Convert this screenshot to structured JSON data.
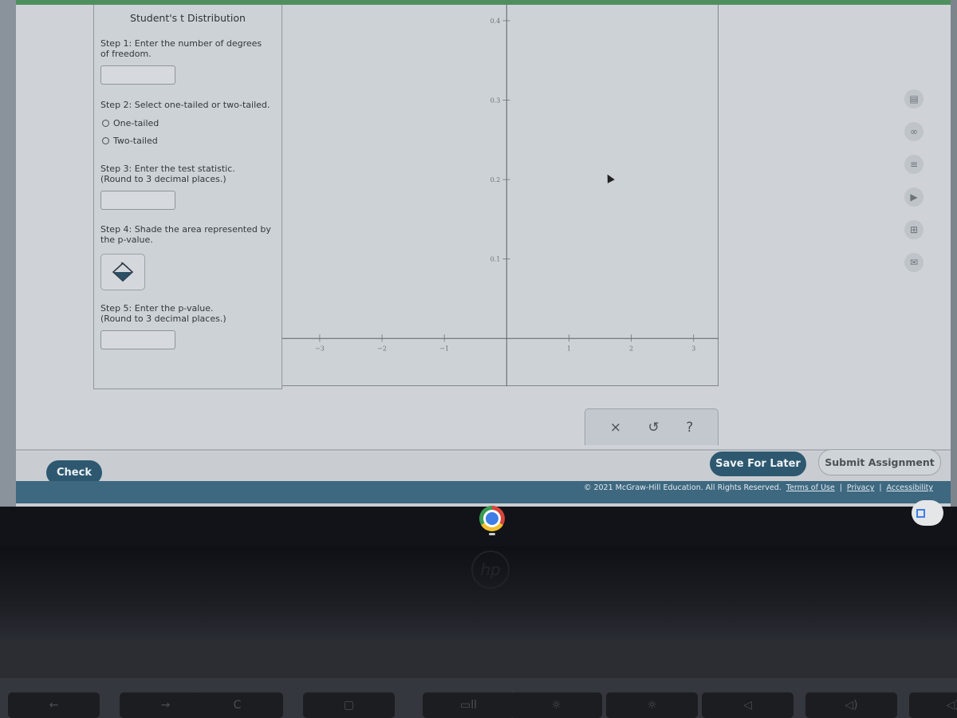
{
  "tool": {
    "title": "Student's t Distribution",
    "step1": {
      "label_line1": "Step 1: Enter the number of degrees",
      "label_line2": "of freedom.",
      "value": ""
    },
    "step2": {
      "label": "Step 2: Select one-tailed or two-tailed.",
      "options": [
        "One-tailed",
        "Two-tailed"
      ],
      "selected": null
    },
    "step3": {
      "label_line1": "Step 3: Enter the test statistic.",
      "label_line2": "(Round to 3 decimal places.)",
      "value": ""
    },
    "step4": {
      "label_line1": "Step 4: Shade the area represented by",
      "label_line2": "the p-value.",
      "tool_icon": "shade-bucket-icon"
    },
    "step5": {
      "label_line1": "Step 5: Enter the p-value.",
      "label_line2": "(Round to 3 decimal places.)",
      "value": ""
    }
  },
  "chart_data": {
    "type": "line",
    "title": "",
    "xlabel": "",
    "ylabel": "",
    "xlim": [
      -3.6,
      3.4
    ],
    "ylim": [
      -0.06,
      0.42
    ],
    "x_ticks": [
      -3,
      -2,
      -1,
      1,
      2,
      3
    ],
    "x_tick_labels": [
      "−3",
      "−2",
      "−1",
      "1",
      "2",
      "3"
    ],
    "y_ticks": [
      0.1,
      0.2,
      0.3,
      0.4
    ],
    "y_tick_labels": [
      "0.1",
      "0.2",
      "0.3",
      "0.4"
    ],
    "series": [],
    "grid": false
  },
  "controls": {
    "clear": "×",
    "undo": "↺",
    "help": "?"
  },
  "actions": {
    "check": "Check",
    "save": "Save For Later",
    "submit": "Submit Assignment"
  },
  "footer": {
    "copyright": "© 2021 McGraw-Hill Education. All Rights Reserved.",
    "links": [
      "Terms of Use",
      "Privacy",
      "Accessibility"
    ],
    "separator": "|"
  },
  "side_icons": [
    "calculator-icon",
    "links-icon",
    "notes-icon",
    "video-icon",
    "reference-icon",
    "mail-icon"
  ],
  "side_glyphs": [
    "▤",
    "∞",
    "≡",
    "▶",
    "⊞",
    "✉"
  ],
  "taskbar": {
    "hp_logo": "hp"
  },
  "keys": [
    "←",
    "→",
    "C",
    "▢",
    "▭ll",
    "☼",
    "☼",
    "◁",
    "◁)",
    "◁))"
  ]
}
